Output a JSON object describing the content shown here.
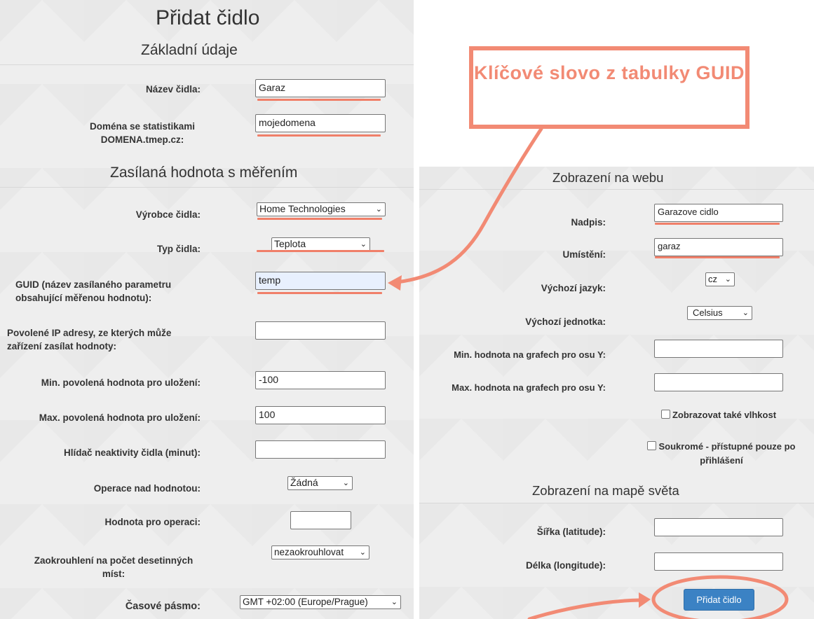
{
  "page_title": "Přidat čidlo",
  "sections": {
    "basic": "Základní údaje",
    "value": "Zasílaná hodnota s měřením",
    "web": "Zobrazení na webu",
    "map": "Zobrazení na mapě světa"
  },
  "left_form": {
    "name": {
      "label": "Název čidla:",
      "value": "Garaz"
    },
    "domain": {
      "label": "Doména se statistikami DOMENA.tmep.cz:",
      "value": "mojedomena"
    },
    "manufacturer": {
      "label": "Výrobce čidla:",
      "value": "Home Technologies"
    },
    "type": {
      "label": "Typ čidla:",
      "value": "Teplota"
    },
    "guid": {
      "label": "GUID (název zasílaného parametru obsahující měřenou hodnotu):",
      "value": "temp"
    },
    "allowed_ips": {
      "label": "Povolené IP adresy, ze kterých může zařízení zasílat hodnoty:",
      "value": ""
    },
    "min_allowed": {
      "label": "Min. povolená hodnota pro uložení:",
      "value": "-100"
    },
    "max_allowed": {
      "label": "Max. povolená hodnota pro uložení:",
      "value": "100"
    },
    "inactivity": {
      "label": "Hlídač neaktivity čidla (minut):",
      "value": ""
    },
    "operation": {
      "label": "Operace nad hodnotou:",
      "value": "Žádná"
    },
    "operation_value": {
      "label": "Hodnota pro operaci:",
      "value": ""
    },
    "rounding": {
      "label": "Zaokrouhlení na počet desetinných míst:",
      "value": "nezaokrouhlovat"
    },
    "timezone": {
      "label": "Časové pásmo:",
      "value": "GMT +02:00 (Europe/Prague)"
    }
  },
  "right_form": {
    "heading": {
      "label": "Nadpis:",
      "value": "Garazove cidlo"
    },
    "location": {
      "label": "Umístění:",
      "value": "garaz"
    },
    "language": {
      "label": "Výchozí jazyk:",
      "value": "cz"
    },
    "unit": {
      "label": "Výchozí jednotka:",
      "value": "Celsius"
    },
    "min_y": {
      "label": "Min. hodnota na grafech pro osu Y:",
      "value": ""
    },
    "max_y": {
      "label": "Max. hodnota na grafech pro osu Y:",
      "value": ""
    },
    "show_humidity": {
      "label": "Zobrazovat také vlhkost",
      "checked": false
    },
    "private": {
      "label": "Soukromé - přístupné pouze po přihlášení",
      "checked": false
    },
    "latitude": {
      "label": "Šířka (latitude):",
      "value": ""
    },
    "longitude": {
      "label": "Délka (longitude):",
      "value": ""
    },
    "submit": "Přidat čidlo"
  },
  "annotation": {
    "callout_text": "Klíčové slovo z tabulky GUID",
    "accent_color": "#f28a74"
  },
  "colors": {
    "panel_bg": "#eeeeee",
    "button_bg": "#3b82c4",
    "underline": "#f07f69"
  }
}
